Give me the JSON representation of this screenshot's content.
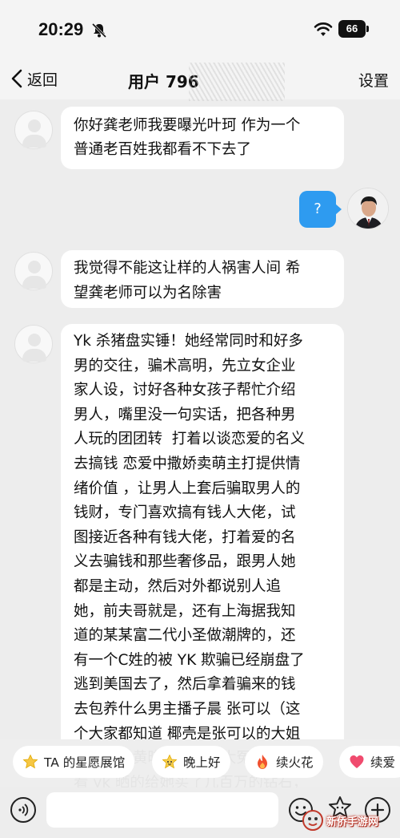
{
  "status_bar": {
    "time": "20:29",
    "battery": "66",
    "icons": [
      "bell-muted-icon",
      "wifi-icon",
      "battery-icon"
    ]
  },
  "nav": {
    "back_label": "返回",
    "title": "用户 796",
    "settings_label": "设置"
  },
  "messages": [
    {
      "from": "other",
      "text": "你好龚老师我要曝光叶珂 作为一个\n普通老百姓我都看不下去了"
    },
    {
      "from": "me",
      "text": "?"
    },
    {
      "from": "other",
      "text": "我觉得不能这让样的人祸害人间 希\n望龚老师可以为名除害"
    },
    {
      "from": "other",
      "text": "Yk 杀猪盘实锤！她经常同时和好多\n男的交往，骗术高明，先立女企业\n家人设，讨好各种女孩子帮忙介绍\n男人，嘴里没一句实话，把各种男\n人玩的团团转  打着以谈恋爱的名义\n去搞钱 恋爱中撒娇卖萌主打提供情\n绪价值 ，让男人上套后骗取男人的\n钱财，专门喜欢搞有钱人大佬，试\n图接近各种有钱大佬，打着爱的名\n义去骗钱和那些奢侈品，跟男人她\n都是主动，然后对外都说别人追\n她，前夫哥就是，还有上海据我知\n道的某某富二代小圣做潮牌的，还\n有一个C姓的被 YK 欺骗已经崩盘了\n逃到美国去了，然后拿着骗来的钱\n去包养什么男主播子晨 张可以（这\n个大家都知道 椰壳是张可以的大姐\n见过面）黄晓明可真是大冤种，我\n看 yk 晒的给她买了几百万的钻石，"
    }
  ],
  "quick_replies": [
    {
      "label": "TA 的星愿展馆",
      "icon": "star-icon"
    },
    {
      "label": "晚上好",
      "icon": "star-face-icon"
    },
    {
      "label": "续火花",
      "icon": "fire-icon"
    },
    {
      "label": "续爱",
      "icon": "heart-icon"
    }
  ],
  "input_bar": {
    "placeholder": "",
    "icons": [
      "voice-icon",
      "emoji-icon",
      "sticker-icon",
      "plus-icon"
    ]
  },
  "watermark": "新侨手游网"
}
